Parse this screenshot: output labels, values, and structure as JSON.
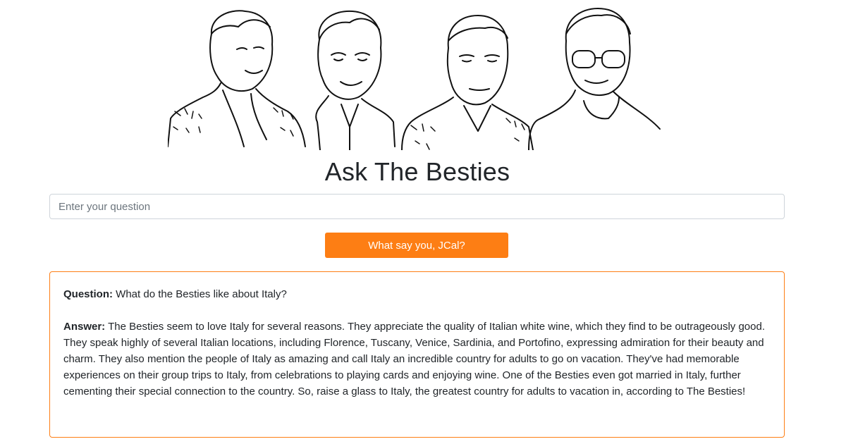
{
  "app": {
    "title": "Ask The Besties",
    "hero_image": "portrait-sketches-of-four-besties"
  },
  "search": {
    "placeholder": "Enter your question",
    "value": ""
  },
  "actions": {
    "ask_label": "What say you, JCal?"
  },
  "result": {
    "question_label": "Question:",
    "question_text": "What do the Besties like about Italy?",
    "answer_label": "Answer:",
    "answer_text": "The Besties seem to love Italy for several reasons. They appreciate the quality of Italian white wine, which they find to be outrageously good. They speak highly of several Italian locations, including Florence, Tuscany, Venice, Sardinia, and Portofino, expressing admiration for their beauty and charm. They also mention the people of Italy as amazing and call Italy an incredible country for adults to go on vacation. They've had memorable experiences on their group trips to Italy, from celebrations to playing cards and enjoying wine. One of the Besties even got married in Italy, further cementing their special connection to the country. So, raise a glass to Italy, the greatest country for adults to vacation in, according to The Besties!"
  },
  "colors": {
    "accent": "#fd7e14",
    "text": "#212529",
    "input_border": "#ced4da"
  }
}
